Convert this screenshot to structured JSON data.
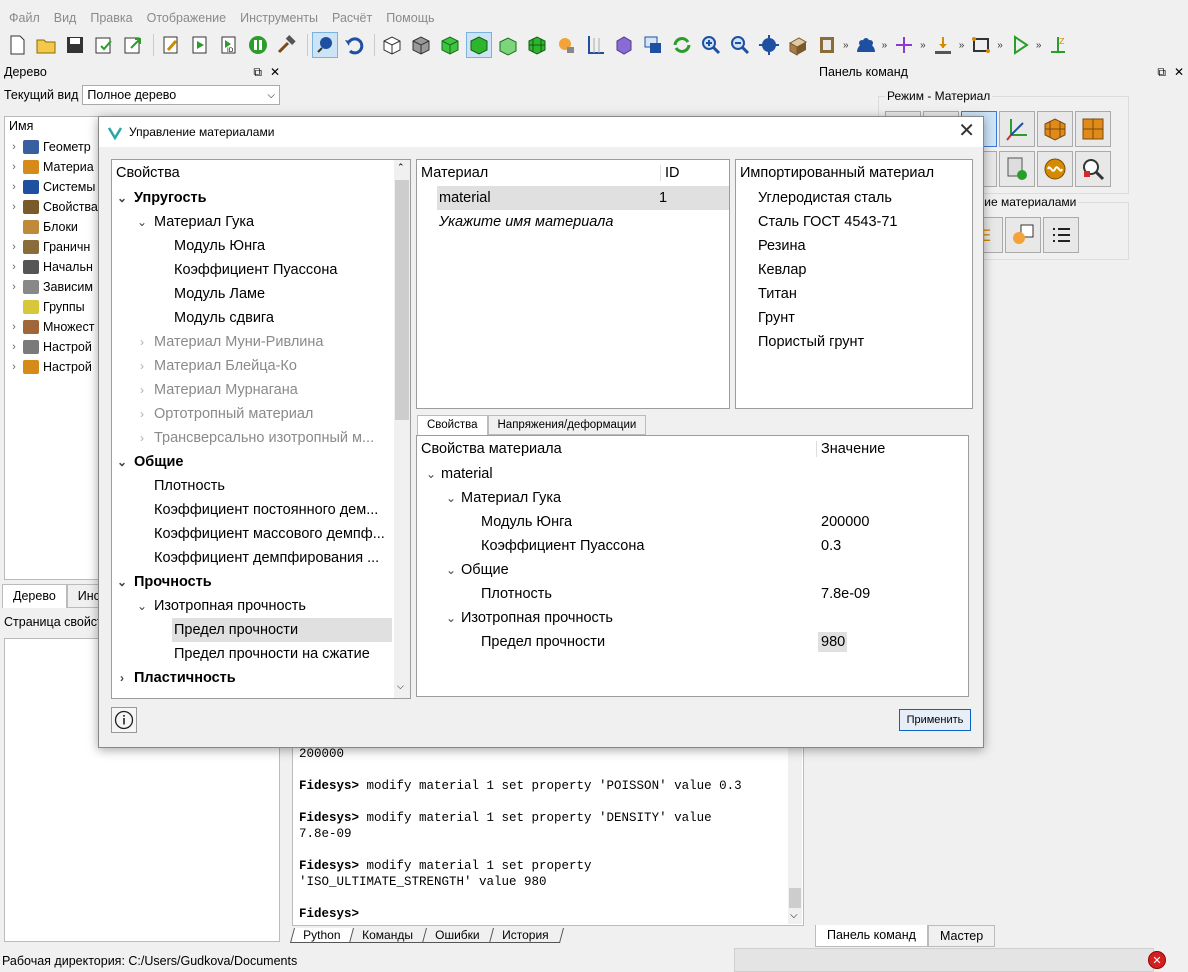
{
  "menu": [
    "Файл",
    "Вид",
    "Правка",
    "Отображение",
    "Инструменты",
    "Расчёт",
    "Помощь"
  ],
  "tree_panel": {
    "title": "Дерево",
    "current_view_label": "Текущий вид",
    "current_view_value": "Полное дерево",
    "column": "Имя",
    "items": [
      "Геометр",
      "Материа",
      "Системы",
      "Свойства",
      "Блоки",
      "Граничн",
      "Начальн",
      "Зависим",
      "Группы",
      "Множест",
      "Настрой",
      "Настрой"
    ]
  },
  "left_tabs": [
    "Дерево",
    "Инс"
  ],
  "property_page_title": "Страница свойств",
  "console": {
    "lines": [
      {
        "prompt": "",
        "text": "200000"
      },
      {
        "prompt": "",
        "text": ""
      },
      {
        "prompt": "Fidesys>",
        "text": " modify material 1 set property 'POISSON' value 0.3"
      },
      {
        "prompt": "",
        "text": ""
      },
      {
        "prompt": "Fidesys>",
        "text": " modify material 1 set property 'DENSITY' value"
      },
      {
        "prompt": "",
        "text": "7.8e-09"
      },
      {
        "prompt": "",
        "text": ""
      },
      {
        "prompt": "Fidesys>",
        "text": " modify material 1 set property"
      },
      {
        "prompt": "",
        "text": "'ISO_ULTIMATE_STRENGTH' value 980"
      },
      {
        "prompt": "",
        "text": ""
      },
      {
        "prompt": "Fidesys>",
        "text": ""
      }
    ],
    "tabs": [
      "Python",
      "Команды",
      "Ошибки",
      "История"
    ]
  },
  "status_bar": "Рабочая директория: C:/Users/Gudkova/Documents",
  "command_panel": {
    "title": "Панель команд",
    "mode_label": "Режим - Материал",
    "group2_label": "ение материалами",
    "tabs": [
      "Панель команд",
      "Мастер"
    ]
  },
  "dialog": {
    "title": "Управление материалами",
    "properties_header": "Свойства",
    "properties_tree": [
      {
        "label": "Упругость",
        "level": 0,
        "style": "bold",
        "arrow": "down"
      },
      {
        "label": "Материал Гука",
        "level": 1,
        "style": "",
        "arrow": "down"
      },
      {
        "label": "Модуль Юнга",
        "level": 2,
        "style": "",
        "arrow": ""
      },
      {
        "label": "Коэффициент Пуассона",
        "level": 2,
        "style": "",
        "arrow": ""
      },
      {
        "label": "Модуль Ламе",
        "level": 2,
        "style": "",
        "arrow": ""
      },
      {
        "label": "Модуль сдвига",
        "level": 2,
        "style": "",
        "arrow": ""
      },
      {
        "label": "Материал Муни-Ривлина",
        "level": 1,
        "style": "gray",
        "arrow": "right"
      },
      {
        "label": "Материал Блейца-Ко",
        "level": 1,
        "style": "gray",
        "arrow": "right"
      },
      {
        "label": "Материал Мурнагана",
        "level": 1,
        "style": "gray",
        "arrow": "right"
      },
      {
        "label": "Ортотропный материал",
        "level": 1,
        "style": "gray",
        "arrow": "right"
      },
      {
        "label": "Трансверсально изотропный м...",
        "level": 1,
        "style": "gray",
        "arrow": "right"
      },
      {
        "label": "Общие",
        "level": 0,
        "style": "bold",
        "arrow": "down"
      },
      {
        "label": "Плотность",
        "level": 1,
        "style": "",
        "arrow": ""
      },
      {
        "label": "Коэффициент постоянного дем...",
        "level": 1,
        "style": "",
        "arrow": ""
      },
      {
        "label": "Коэффициент массового демпф...",
        "level": 1,
        "style": "",
        "arrow": ""
      },
      {
        "label": "Коэффициент демпфирования ...",
        "level": 1,
        "style": "",
        "arrow": ""
      },
      {
        "label": "Прочность",
        "level": 0,
        "style": "bold",
        "arrow": "down"
      },
      {
        "label": "Изотропная прочность",
        "level": 1,
        "style": "",
        "arrow": "down"
      },
      {
        "label": "Предел прочности",
        "level": 2,
        "style": "sel",
        "arrow": ""
      },
      {
        "label": "Предел прочности на сжатие",
        "level": 2,
        "style": "",
        "arrow": ""
      },
      {
        "label": "Пластичность",
        "level": 0,
        "style": "bold",
        "arrow": "right"
      }
    ],
    "materials_header": {
      "name": "Материал",
      "id": "ID"
    },
    "materials": [
      {
        "name": "material",
        "id": "1"
      }
    ],
    "new_material_placeholder": "Укажите имя материала",
    "imported_header": "Импортированный материал",
    "imported": [
      "Углеродистая сталь",
      "Сталь ГОСТ 4543-71",
      "Резина",
      "Кевлар",
      "Титан",
      "Грунт",
      "Пористый грунт"
    ],
    "tabs": [
      "Свойства",
      "Напряжения/деформации"
    ],
    "values_header": {
      "prop": "Свойства материала",
      "value": "Значение"
    },
    "values": [
      {
        "label": "material",
        "level": 0,
        "arrow": "down",
        "value": ""
      },
      {
        "label": "Материал Гука",
        "level": 1,
        "arrow": "down",
        "value": ""
      },
      {
        "label": "Модуль Юнга",
        "level": 2,
        "arrow": "",
        "value": "200000"
      },
      {
        "label": "Коэффициент Пуассона",
        "level": 2,
        "arrow": "",
        "value": "0.3"
      },
      {
        "label": "Общие",
        "level": 1,
        "arrow": "down",
        "value": ""
      },
      {
        "label": "Плотность",
        "level": 2,
        "arrow": "",
        "value": "7.8e-09"
      },
      {
        "label": "Изотропная прочность",
        "level": 1,
        "arrow": "down",
        "value": ""
      },
      {
        "label": "Предел прочности",
        "level": 2,
        "arrow": "",
        "value": "980",
        "highlight": true
      }
    ],
    "apply_label": "Применить"
  }
}
